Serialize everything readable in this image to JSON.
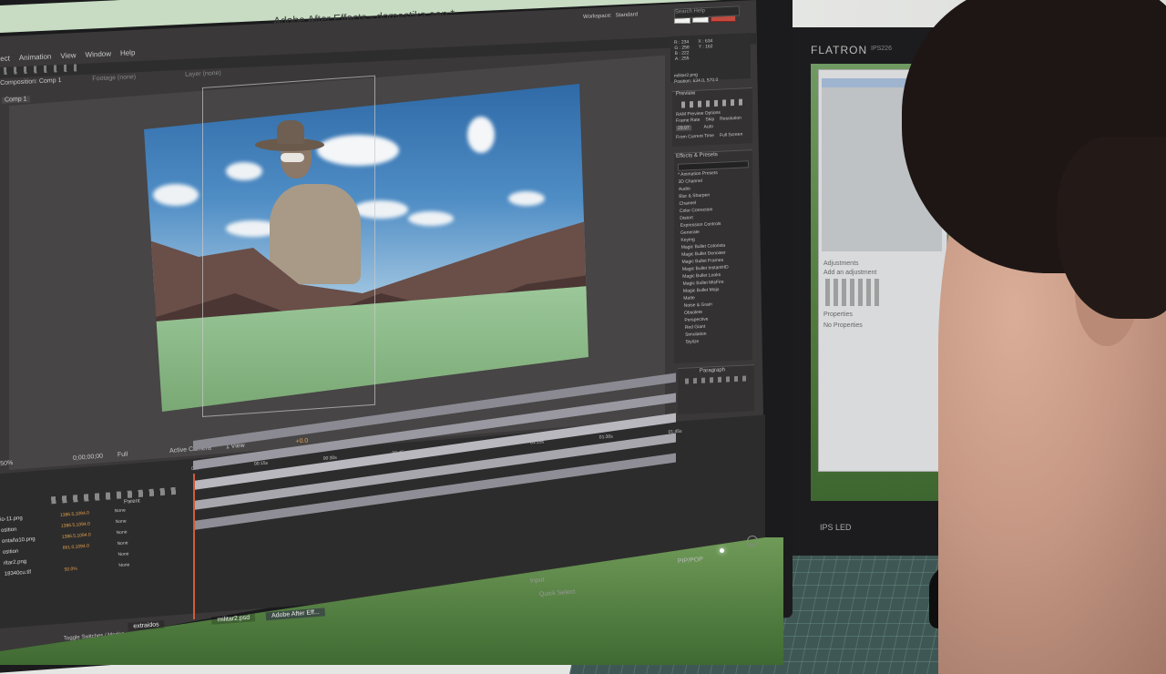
{
  "window": {
    "title": "Adobe After Effects - domestika.aep *"
  },
  "menu": {
    "items": [
      "ect",
      "Animation",
      "View",
      "Window",
      "Help"
    ]
  },
  "workspace": {
    "label": "Workspace:",
    "value": "Standard",
    "search_placeholder": "Search Help"
  },
  "panels": {
    "composition_tab": "Composition: Comp 1",
    "footage_tab": "Footage (none)",
    "layer_tab": "Layer (none)",
    "comp_subtab": "Comp 1"
  },
  "viewer_footer": {
    "zoom": "50%",
    "timecode": "0;00;00;00",
    "resolution": "Full",
    "camera": "Active Camera",
    "views": "1 View",
    "exposure": "+0.0"
  },
  "preview_panel": {
    "title": "Preview",
    "frame_rate": "Frame Rate",
    "skip": "Skip",
    "resolution": "Resolution",
    "fps": "29.97",
    "auto": "Auto",
    "from_current": "From Current Time",
    "full_screen": "Full Screen",
    "ram_options": "RAM Preview Options"
  },
  "effects_panel": {
    "title": "Effects & Presets",
    "items": [
      "* Animation Presets",
      "3D Channel",
      "Audio",
      "Blur & Sharpen",
      "Channel",
      "Color Correction",
      "Distort",
      "Expression Controls",
      "Generate",
      "Keying",
      "Magic Bullet Colorista",
      "Magic Bullet Denoiser",
      "Magic Bullet Frames",
      "Magic Bullet InstantHD",
      "Magic Bullet Looks",
      "Magic Bullet MisFire",
      "Magic Bullet Mojo",
      "Matte",
      "Noise & Grain",
      "Obsolete",
      "Perspective",
      "Red Giant",
      "Simulation",
      "Stylize"
    ]
  },
  "paragraph_panel": {
    "title": "Paragraph"
  },
  "timeline": {
    "ruler": [
      "00s",
      "00:15s",
      "00:30s",
      "00:45s",
      "01:00s",
      "01:15s",
      "01:30s",
      "01:45s"
    ],
    "parent_header": "Parent",
    "layers": [
      {
        "name": "io-11.png",
        "value": "1386.5,1094.0",
        "parent": "None"
      },
      {
        "name": "osition",
        "value": "1386.5,1094.0",
        "parent": "None"
      },
      {
        "name": "ontaña10.png",
        "value": "1386.5,1094.0",
        "parent": "None"
      },
      {
        "name": "osition",
        "value": "661.0,1094.0",
        "parent": "None"
      },
      {
        "name": "ritar2.png",
        "value": "",
        "parent": "None"
      },
      {
        "name": "18340cu.tif",
        "value": "50.0%",
        "parent": "None"
      }
    ],
    "toggle_label": "Toggle Switches / Modes"
  },
  "taskbar": {
    "items": [
      "extraidos",
      "militar2.psd",
      "Adobe After Eff..."
    ]
  },
  "keyboard": {
    "quick_select": "Quick Select",
    "input": "Input",
    "pip": "PIP/POP"
  },
  "monitor2": {
    "brand": "FLATRON",
    "model": "IPS226",
    "brand_bottom": "IPS LED",
    "adjustments": "Adjustments",
    "add_adjustment": "Add an adjustment",
    "properties": "Properties",
    "no_properties": "No Properties"
  },
  "info_panel": {
    "values": [
      "R : 234",
      "G : 258",
      "B : 222",
      "A : 255"
    ],
    "coords": [
      "X : 634",
      "Y : 162"
    ],
    "layer": "militar2.png",
    "position": "Position: 634.0, 570.0"
  },
  "colors": {
    "ae_bg": "#3a3838",
    "sky": "#3f7fb8",
    "grass": "#8fb98a",
    "monitor_bezel": "#1b1b1d",
    "skin": "#c89a86",
    "hair": "#1d1614"
  }
}
